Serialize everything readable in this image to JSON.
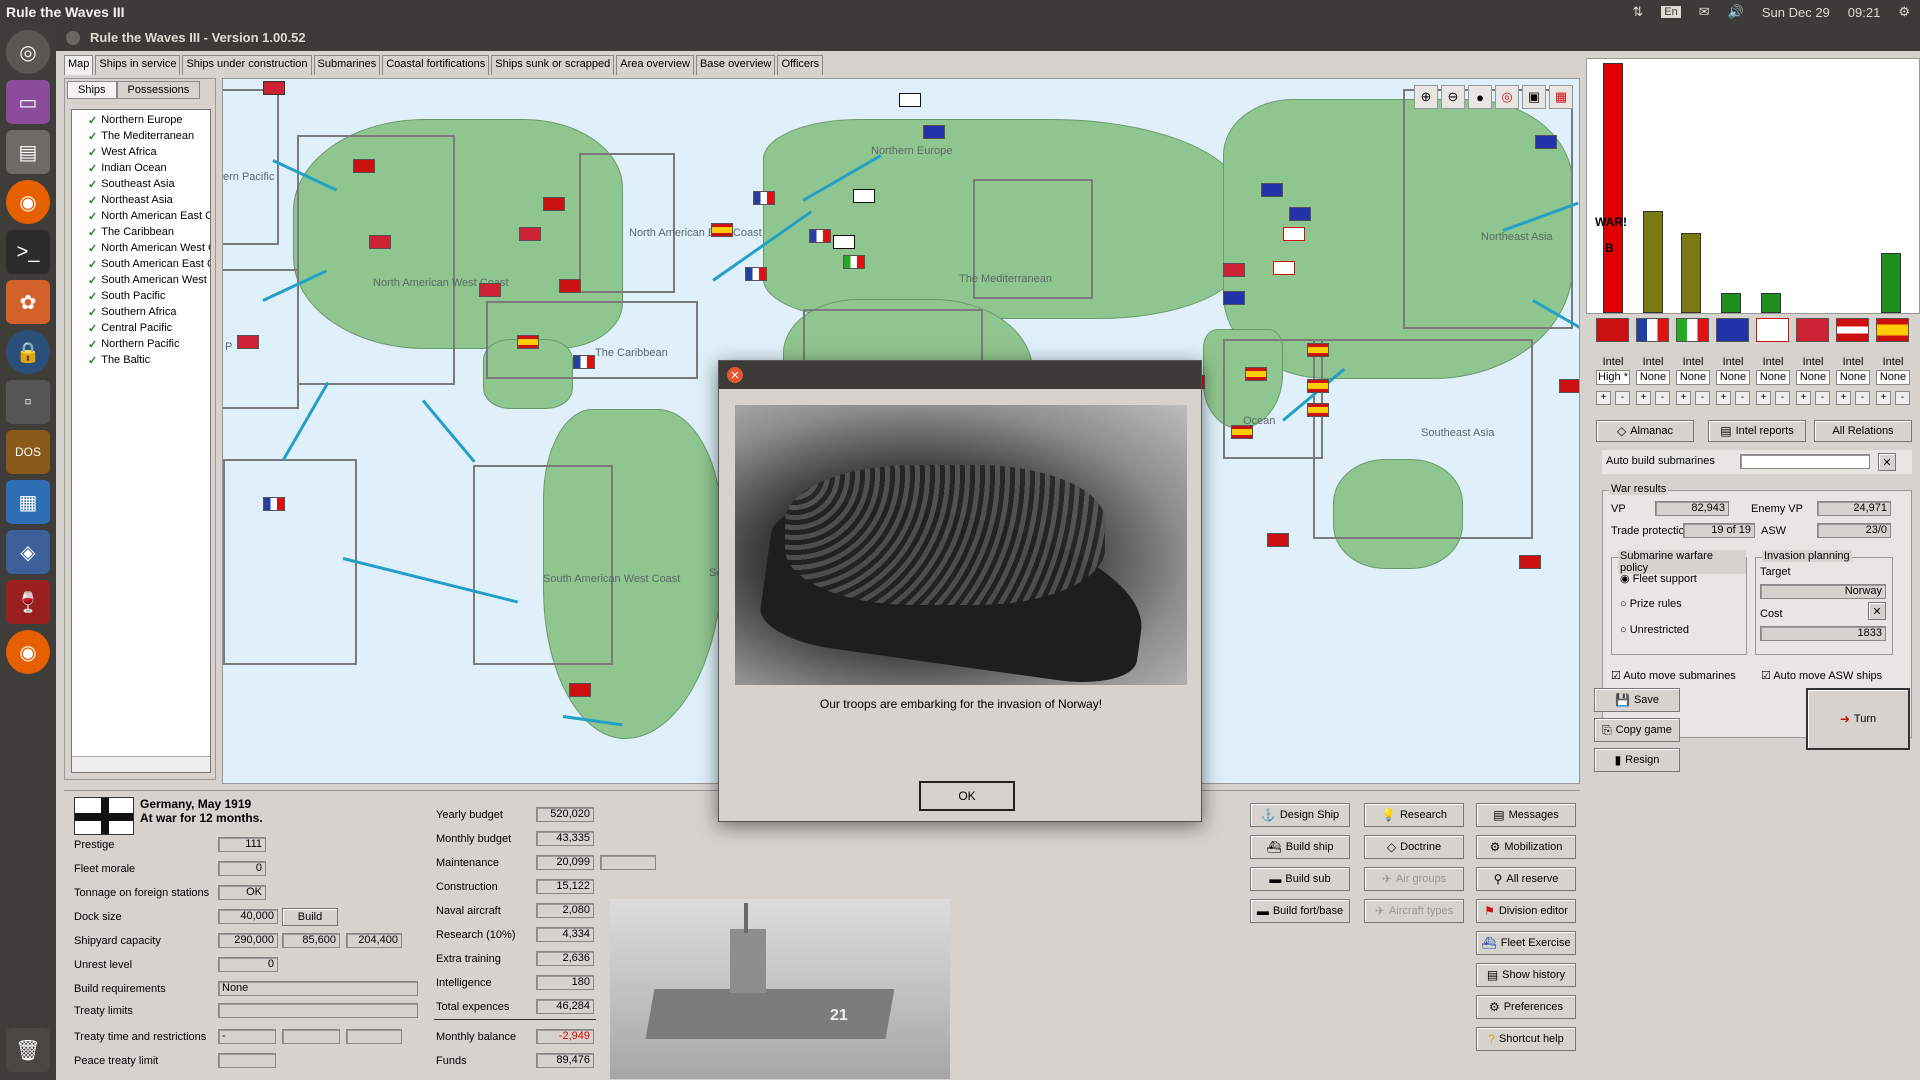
{
  "system": {
    "app_name": "Rule the Waves III",
    "lang": "En",
    "date": "Sun Dec 29",
    "time": "09:21"
  },
  "window": {
    "title": "Rule the Waves III - Version 1.00.52"
  },
  "tabs": [
    "Map",
    "Ships in service",
    "Ships under construction",
    "Submarines",
    "Coastal fortifications",
    "Ships sunk or scrapped",
    "Area overview",
    "Base overview",
    "Officers"
  ],
  "left": {
    "subtabs": [
      "Ships",
      "Possessions"
    ],
    "areas": [
      "Northern Europe",
      "The Mediterranean",
      "West Africa",
      "Indian Ocean",
      "Southeast Asia",
      "Northeast Asia",
      "North American East Coast",
      "The Caribbean",
      "North American West Coast",
      "South American East Coast",
      "South American West Coast",
      "South Pacific",
      "Southern Africa",
      "Central Pacific",
      "Northern Pacific",
      "The Baltic"
    ]
  },
  "map": {
    "labels": [
      "Northern Europe",
      "ern Pacific",
      "North American East Coast",
      "North American West Coast",
      "The Caribbean",
      "The Mediterranean",
      "South American West Coast",
      "Northeast Asia",
      "Southeast Asia",
      "Ocean",
      "P",
      "Sc"
    ],
    "tools": [
      "zoom-in-icon",
      "zoom-out-icon",
      "drop-icon",
      "target-icon",
      "layers-icon",
      "grid-icon"
    ]
  },
  "right": {
    "chart": {
      "war_label": "WAR!",
      "b_label": "B",
      "bar_colors": [
        "#e00000",
        "#7a7a12",
        "#7a7a12",
        "#1f8f1f",
        "#1f8f1f",
        "#1f8f1f"
      ]
    },
    "intel": [
      {
        "label": "Intel",
        "value": "High *"
      },
      {
        "label": "Intel",
        "value": "None"
      },
      {
        "label": "Intel",
        "value": "None"
      },
      {
        "label": "Intel",
        "value": "None"
      },
      {
        "label": "Intel",
        "value": "None"
      },
      {
        "label": "Intel",
        "value": "None"
      },
      {
        "label": "Intel",
        "value": "None"
      },
      {
        "label": "Intel",
        "value": "None"
      }
    ],
    "buttons": {
      "almanac": "Almanac",
      "intel_reports": "Intel reports",
      "all_relations": "All Relations"
    },
    "auto_build_subs": "Auto build submarines",
    "war_results": {
      "title": "War results",
      "vp_label": "VP",
      "vp": "82,943",
      "enemy_vp_label": "Enemy VP",
      "enemy_vp": "24,971",
      "trade_label": "Trade protection",
      "trade": "19 of 19",
      "asw_label": "ASW",
      "asw": "23/0"
    },
    "sub_policy": {
      "title": "Submarine warfare policy",
      "opts": [
        "Fleet support",
        "Prize rules",
        "Unrestricted"
      ]
    },
    "invasion": {
      "title": "Invasion planning",
      "target_label": "Target",
      "target": "Norway",
      "cost_label": "Cost",
      "cost": "1833"
    },
    "checks": {
      "auto_move_subs": "Auto move submarines",
      "auto_move_asw": "Auto move ASW ships"
    },
    "save": "Save",
    "copy_game": "Copy game",
    "resign": "Resign",
    "turn": "Turn"
  },
  "bottom": {
    "nation": "Germany, May 1919",
    "war_status": "At war for 12 months.",
    "stats": [
      {
        "label": "Prestige",
        "value": "111"
      },
      {
        "label": "Fleet morale",
        "value": "0"
      },
      {
        "label": "Tonnage on foreign stations",
        "value": "OK"
      },
      {
        "label": "Dock size",
        "value": "40,000"
      },
      {
        "label": "Shipyard capacity",
        "value": "290,000"
      },
      {
        "label": "Unrest level",
        "value": "0"
      },
      {
        "label": "Build requirements",
        "value": "None"
      },
      {
        "label": "Treaty limits",
        "value": ""
      },
      {
        "label": "Treaty time and restrictions",
        "value": "-"
      },
      {
        "label": "Peace treaty limit",
        "value": ""
      }
    ],
    "dock_build": "Build",
    "shipyard_extra": [
      "85,600",
      "204,400"
    ],
    "budget": [
      {
        "label": "Yearly budget",
        "value": "520,020"
      },
      {
        "label": "Monthly budget",
        "value": "43,335"
      },
      {
        "label": "Maintenance",
        "value": "20,099"
      },
      {
        "label": "Construction",
        "value": "15,122"
      },
      {
        "label": "Naval aircraft",
        "value": "2,080"
      },
      {
        "label": "Research (10%)",
        "value": "4,334"
      },
      {
        "label": "Extra training",
        "value": "2,636"
      },
      {
        "label": "Intelligence",
        "value": "180"
      },
      {
        "label": "Total expences",
        "value": "46,284"
      },
      {
        "label": "Monthly balance",
        "value": "-2,949"
      },
      {
        "label": "Funds",
        "value": "89,476"
      }
    ],
    "ship_number": "21",
    "actions": [
      [
        "Design Ship",
        "Research",
        "Messages"
      ],
      [
        "Build ship",
        "Doctrine",
        "Mobilization"
      ],
      [
        "Build sub",
        "Air groups",
        "All reserve"
      ],
      [
        "Build fort/base",
        "Aircraft types",
        "Division editor"
      ],
      [
        "",
        "",
        "Fleet Exercise"
      ],
      [
        "",
        "",
        "Show history"
      ],
      [
        "",
        "",
        "Preferences"
      ],
      [
        "",
        "",
        "Shortcut help"
      ]
    ]
  },
  "dialog": {
    "message": "Our troops are embarking for the invasion of Norway!",
    "ok": "OK"
  }
}
